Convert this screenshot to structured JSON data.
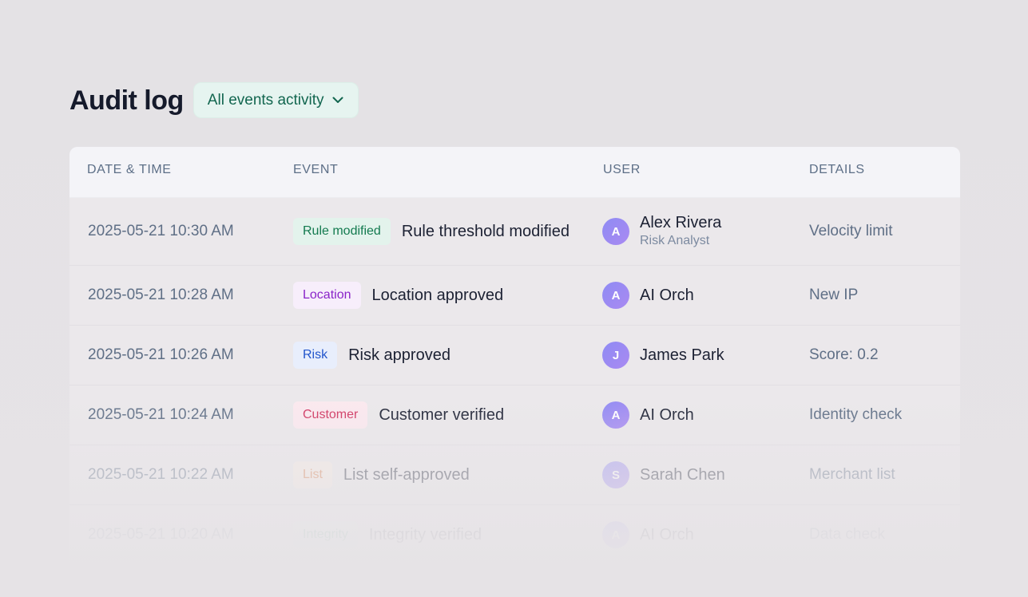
{
  "page": {
    "title": "Audit log",
    "filter_label": "All events activity"
  },
  "table": {
    "headers": {
      "date": "DATE & TIME",
      "event": "EVENT",
      "user": "USER",
      "details": "DETAILS"
    },
    "rows": [
      {
        "datetime": "2025-05-21 10:30 AM",
        "badge": "Rule modified",
        "badge_bg": "#e3f3ec",
        "badge_fg": "#137a4f",
        "event": "Rule threshold modified",
        "avatar": "A",
        "user": "Alex Rivera",
        "role": "Risk Analyst",
        "details": "Velocity limit"
      },
      {
        "datetime": "2025-05-21 10:28 AM",
        "badge": "Location",
        "badge_bg": "#f7eefb",
        "badge_fg": "#8a24c9",
        "event": "Location approved",
        "avatar": "A",
        "user": "AI Orch",
        "role": "",
        "details": "New IP"
      },
      {
        "datetime": "2025-05-21 10:26 AM",
        "badge": "Risk",
        "badge_bg": "#e8eefc",
        "badge_fg": "#2255cc",
        "event": "Risk approved",
        "avatar": "J",
        "user": "James Park",
        "role": "",
        "details": "Score: 0.2"
      },
      {
        "datetime": "2025-05-21 10:24 AM",
        "badge": "Customer",
        "badge_bg": "#fbe9ef",
        "badge_fg": "#d0335f",
        "event": "Customer verified",
        "avatar": "A",
        "user": "AI Orch",
        "role": "",
        "details": "Identity check"
      },
      {
        "datetime": "2025-05-21 10:22 AM",
        "badge": "List",
        "badge_bg": "#fbeee6",
        "badge_fg": "#d9773e",
        "event": "List self-approved",
        "avatar": "S",
        "user": "Sarah Chen",
        "role": "",
        "details": "Merchant list"
      },
      {
        "datetime": "2025-05-21 10:20 AM",
        "badge": "Integrity",
        "badge_bg": "#e5f3ec",
        "badge_fg": "#1d8a5c",
        "event": "Integrity verified",
        "avatar": "A",
        "user": "AI Orch",
        "role": "",
        "details": "Data check"
      }
    ]
  },
  "icons": {
    "filter_chevron": "chevron-down-icon"
  },
  "colors": {
    "title": "#151a2b",
    "filter_bg": "#e6f4f0",
    "filter_fg": "#12664f",
    "header_text": "#5d6f87",
    "avatar_gradient_start": "#8f8bf4",
    "avatar_gradient_end": "#a98af1"
  }
}
